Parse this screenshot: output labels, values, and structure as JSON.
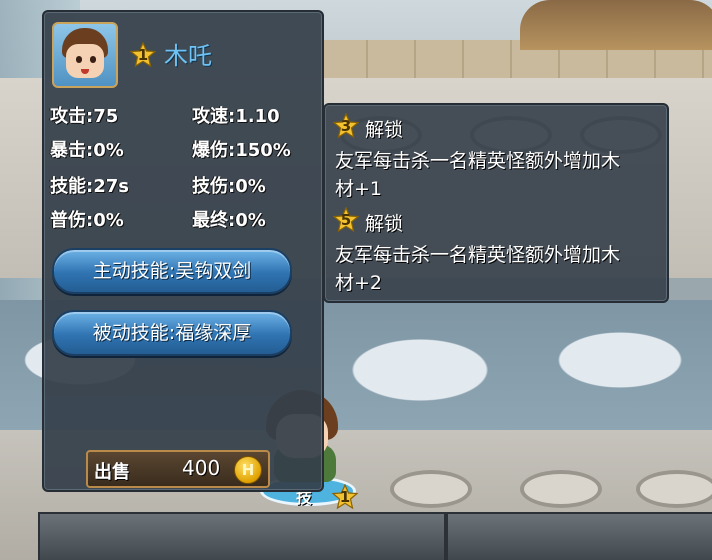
{
  "hero": {
    "star_level": "1",
    "name": "木吒"
  },
  "stats": {
    "attack": "攻击:75",
    "attack_speed": "攻速:1.10",
    "crit": "暴击:0%",
    "crit_damage": "爆伤:150%",
    "skill_cd": "技能:27s",
    "skill_damage": "技伤:0%",
    "normal_damage": "普伤:0%",
    "final_damage": "最终:0%"
  },
  "skills": {
    "active_label": "主动技能:吴钩双剑",
    "passive_label": "被动技能:福缘深厚"
  },
  "sell": {
    "label": "出售",
    "price": "400",
    "coin_symbol": "H"
  },
  "unlocks": [
    {
      "star": "3",
      "title": "解锁",
      "desc_line1": "友军每击杀一名精英怪额外增加木",
      "desc_line2": "材+1"
    },
    {
      "star": "5",
      "title": "解锁",
      "desc_line1": "友军每击杀一名精英怪额外增加木",
      "desc_line2": "材+2"
    }
  ],
  "field_unit": {
    "label": "技",
    "star_level": "1"
  },
  "colors": {
    "panel_bg": "#353f4a",
    "hero_name": "#6fc3f4",
    "skill_button": "#2f74b2",
    "star_gold": "#f2c230",
    "coin": "#e0a100"
  },
  "icons": {
    "star": "star-icon",
    "coin": "coin-icon"
  }
}
